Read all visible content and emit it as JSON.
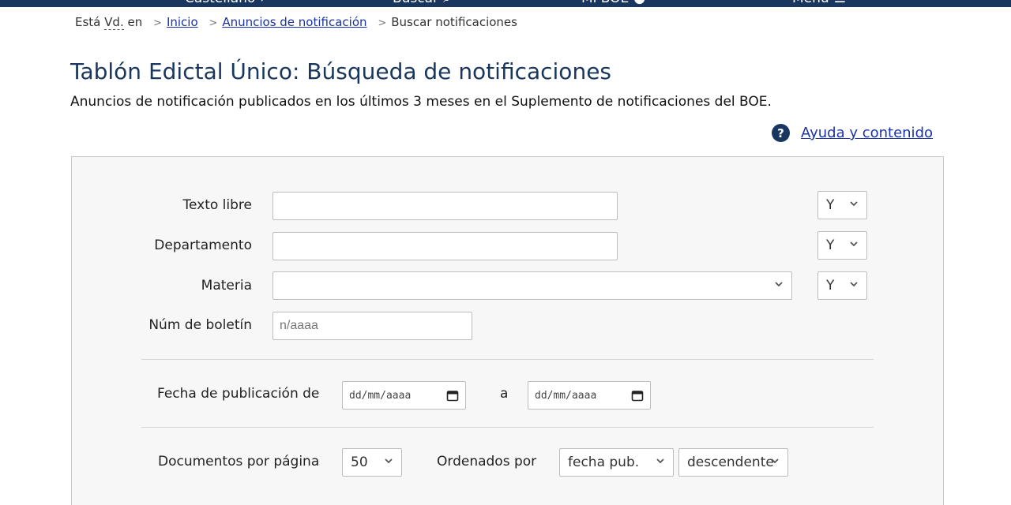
{
  "topbar": {
    "items": [
      "Castellano",
      "Buscar",
      "Mi BOE",
      "Menú"
    ]
  },
  "breadcrumb": {
    "prefix": "Está",
    "abbr": "Vd.",
    "suffix": "en",
    "items": [
      "Inicio",
      "Anuncios de notificación",
      "Buscar notificaciones"
    ]
  },
  "page": {
    "title": "Tablón Edictal Único: Búsqueda de notificaciones",
    "subtitle": "Anuncios de notificación publicados en los últimos 3 meses en el Suplemento de notificaciones del BOE."
  },
  "help": {
    "icon": "question-circle-icon",
    "label": "Ayuda y contenido"
  },
  "form": {
    "texto_libre": {
      "label": "Texto libre",
      "value": "",
      "operator": "Y"
    },
    "departamento": {
      "label": "Departamento",
      "value": "",
      "operator": "Y"
    },
    "materia": {
      "label": "Materia",
      "value": "",
      "operator": "Y"
    },
    "num_boletin": {
      "label": "Núm de boletín",
      "placeholder": "n/aaaa"
    },
    "fecha": {
      "label": "Fecha de publicación de",
      "from": "dd/mm/aaaa",
      "separator": "a",
      "to": "dd/mm/aaaa"
    },
    "docs_por_pagina": {
      "label": "Documentos por página",
      "value": "50"
    },
    "ordenados_por": {
      "label": "Ordenados por",
      "field": "fecha pub.",
      "direction": "descendente"
    }
  },
  "colors": {
    "brand": "#19365e",
    "link": "#1a33a6",
    "panel": "#f7f7f7"
  }
}
